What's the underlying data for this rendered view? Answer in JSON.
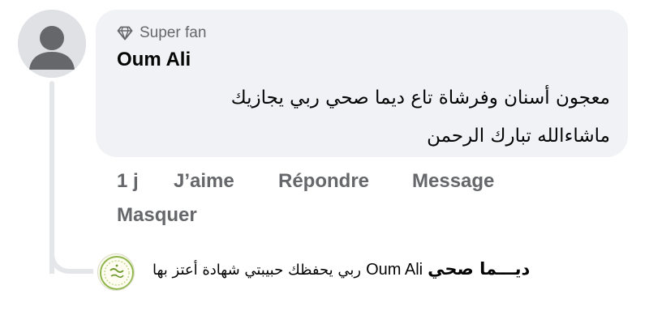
{
  "comment": {
    "badge_icon": "diamond-icon",
    "badge_label": "Super fan",
    "author": "Oum Ali",
    "text_line1": "معجون أسنان وفرشاة تاع ديما صحي ربي يجازيك",
    "text_line2": "ماشاءالله تبارك الرحمن",
    "bubble_color": "#f0f2f5"
  },
  "actions": {
    "time": "1 j",
    "like": "J’aime",
    "reply": "Répondre",
    "message": "Message",
    "hide": "Masquer",
    "color": "#65676b"
  },
  "reply": {
    "author": "ديـــما صحي",
    "mention": "Oum Ali",
    "text": "ربي يحفظك حبيبتي شهادة أعتز بها",
    "avatar_icon": "logo-icon"
  }
}
